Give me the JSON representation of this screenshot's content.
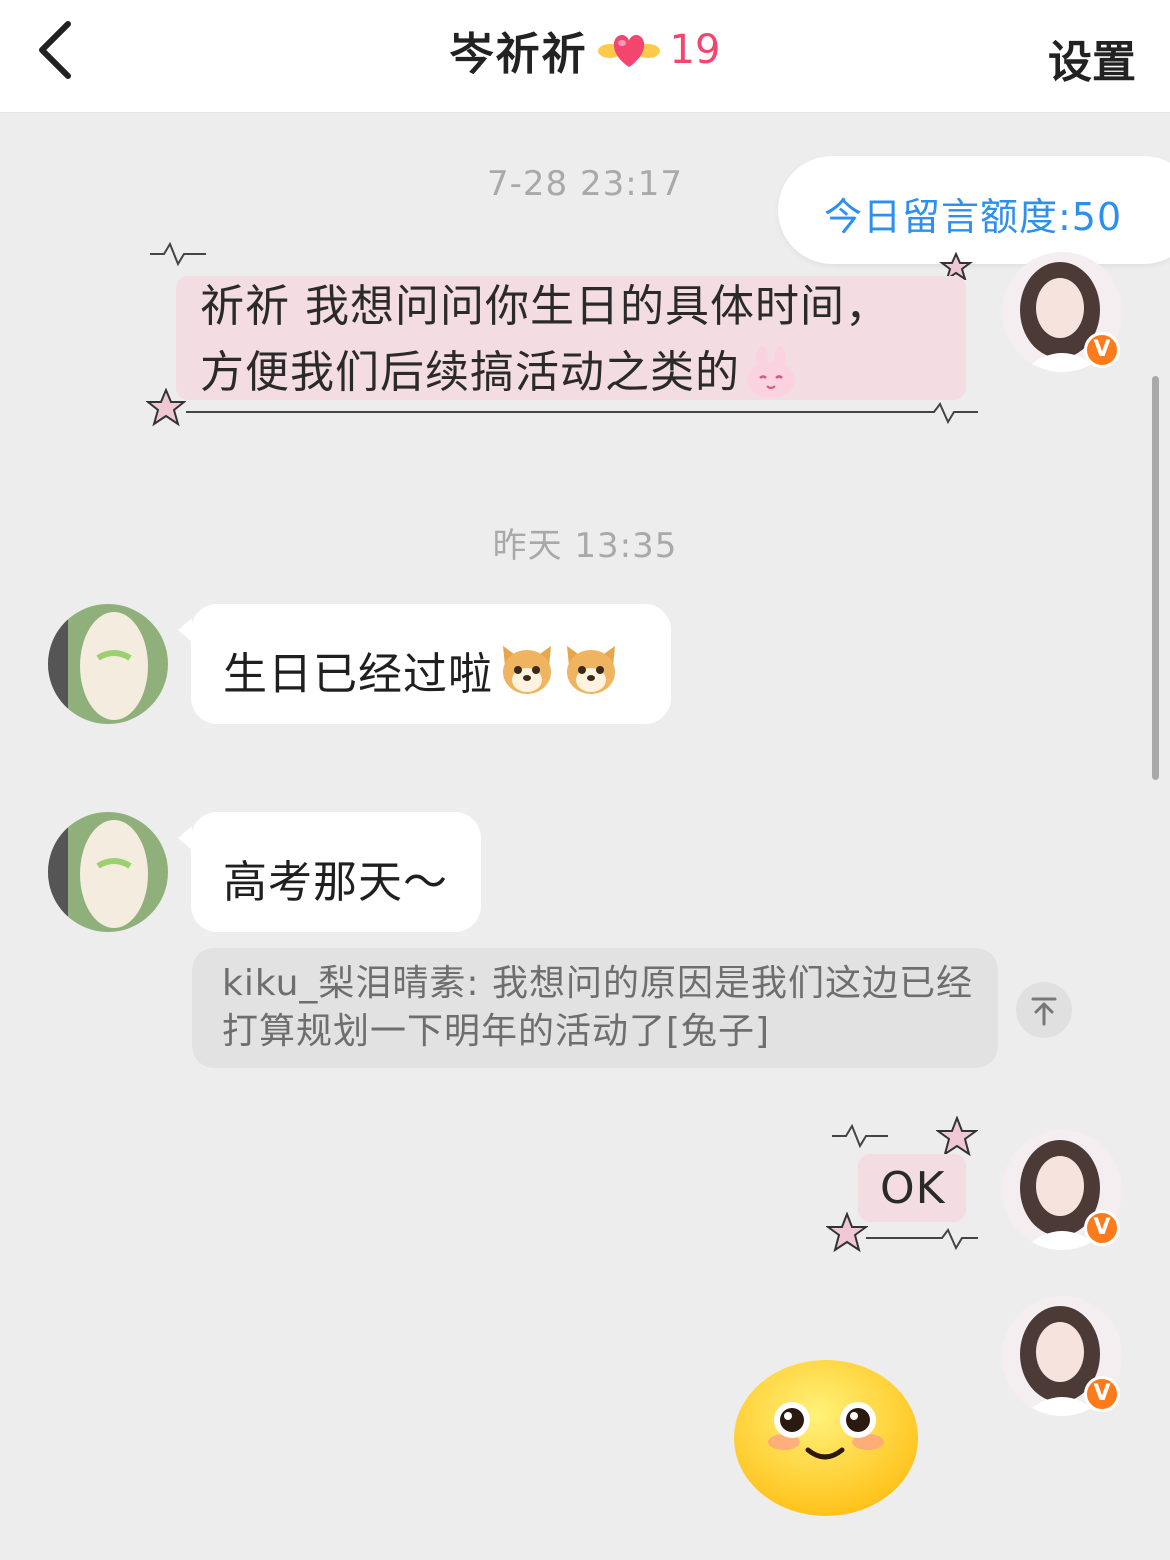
{
  "header": {
    "title": "岑祈祈",
    "heart_count": "19",
    "settings_label": "设置"
  },
  "quota": {
    "label": "今日留言额度:50"
  },
  "timestamps": {
    "first": "7-28 23:17",
    "second": "昨天 13:35"
  },
  "messages": {
    "outgoing_1": {
      "line1": "祈祈 我想问问你生日的具体时间，",
      "line2": "方便我们后续搞活动之类的"
    },
    "incoming_1": {
      "text": "生日已经过啦"
    },
    "incoming_2": {
      "text": "高考那天～",
      "quote": "kiku_梨泪晴素: 我想问的原因是我们这边已经打算规划一下明年的活动了[兔子]"
    },
    "outgoing_2": {
      "text": "OK"
    }
  },
  "badges": {
    "verified": "V"
  },
  "colors": {
    "accent_blue": "#2d8ff0",
    "heart_pink": "#f4456e",
    "bubble_pink": "#f3dde3",
    "badge_orange": "#ff7a1a",
    "page_bg": "#ededed"
  },
  "icons": {
    "back": "chevron-left-icon",
    "heart": "winged-heart-icon",
    "bunny": "bunny-emoji-icon",
    "dog": "shiba-dog-emoji-icon",
    "to_top": "arrow-up-to-top-icon",
    "smiley": "blushing-smiley-sticker-icon",
    "star": "star-sparkle-icon"
  }
}
